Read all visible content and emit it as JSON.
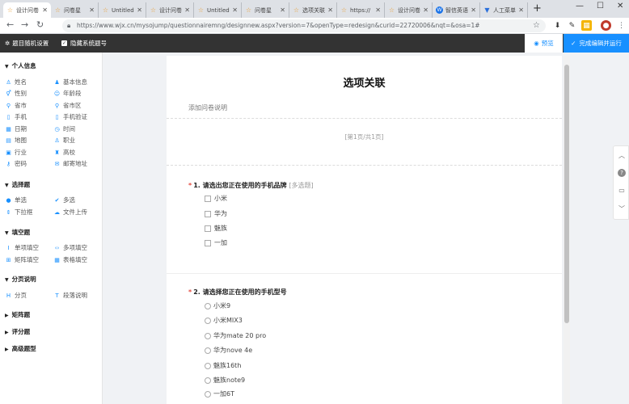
{
  "browser": {
    "tabs": [
      {
        "title": "设计问卷",
        "icon": "star-icon",
        "active": true
      },
      {
        "title": "问卷星",
        "icon": "star-icon"
      },
      {
        "title": "Untitled",
        "icon": "star-icon"
      },
      {
        "title": "设计问卷",
        "icon": "star-icon"
      },
      {
        "title": "Untitled",
        "icon": "star-icon"
      },
      {
        "title": "问卷星",
        "icon": "star-icon"
      },
      {
        "title": "选项关联",
        "icon": "star-icon"
      },
      {
        "title": "https://",
        "icon": "star-icon"
      },
      {
        "title": "设计问卷",
        "icon": "star-icon"
      },
      {
        "title": "智信英语",
        "icon": "brand-icon"
      },
      {
        "title": "人工菜单",
        "icon": "tooth-icon"
      }
    ],
    "url": "https://www.wjx.cn/mysojump/questionnairemng/designnew.aspx?version=7&openType=redesign&curid=22720006&nqt=&osa=1#"
  },
  "appbar": {
    "settings_label": "题目随机设置",
    "hide_number_label": "隐藏系统题号",
    "preview_label": "预览",
    "finish_label": "完成编辑并运行"
  },
  "sidebar": {
    "personal": {
      "title": "个人信息",
      "items": [
        "姓名",
        "基本信息",
        "性别",
        "年龄段",
        "省市",
        "省市区",
        "手机",
        "手机验证",
        "日期",
        "时间",
        "地图",
        "职业",
        "行业",
        "高校",
        "密码",
        "邮寄地址"
      ]
    },
    "choice": {
      "title": "选择题",
      "items": [
        "单选",
        "多选",
        "下拉框",
        "文件上传"
      ]
    },
    "fill": {
      "title": "填空题",
      "items": [
        "单项填空",
        "多项填空",
        "矩阵填空",
        "表格填空"
      ]
    },
    "paging": {
      "title": "分页说明",
      "items": [
        "分页",
        "段落说明"
      ]
    },
    "matrix_title": "矩阵题",
    "rating_title": "评分题",
    "advanced_title": "高级题型"
  },
  "survey": {
    "title": "选项关联",
    "description": "添加问卷说明",
    "page_info": "[第1页/共1页]",
    "q1": {
      "number": "1.",
      "title": "请选出您正在使用的手机品牌",
      "hint": "[多选题]",
      "options": [
        "小米",
        "华为",
        "魅族",
        "一加"
      ]
    },
    "q2": {
      "number": "2.",
      "title": "请选择您正在使用的手机型号",
      "options": [
        "小米9",
        "小米MIX3",
        "华为mate 20 pro",
        "华为nove 4e",
        "魅族16th",
        "魅族note9",
        "一加6T"
      ]
    }
  },
  "colors": {
    "accent": "#1890ff",
    "appbar": "#333333",
    "required": "#e54d42"
  }
}
